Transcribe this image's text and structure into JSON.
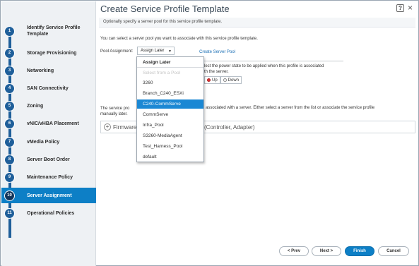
{
  "window": {
    "title": "Create Service Profile Template",
    "subtitle": "Optionally specify a server pool for this service profile template.",
    "help_label": "?",
    "close_label": "×"
  },
  "sidebar": {
    "steps": [
      {
        "num": "1",
        "label": "Identify Service Profile Template"
      },
      {
        "num": "2",
        "label": "Storage Provisioning"
      },
      {
        "num": "3",
        "label": "Networking"
      },
      {
        "num": "4",
        "label": "SAN Connectivity"
      },
      {
        "num": "5",
        "label": "Zoning"
      },
      {
        "num": "6",
        "label": "vNIC/vHBA Placement"
      },
      {
        "num": "7",
        "label": "vMedia Policy"
      },
      {
        "num": "8",
        "label": "Server Boot Order"
      },
      {
        "num": "9",
        "label": "Maintenance Policy"
      },
      {
        "num": "10",
        "label": "Server Assignment"
      },
      {
        "num": "11",
        "label": "Operational Policies"
      }
    ],
    "active_step": "10",
    "accent_color": "#0d7fc6"
  },
  "main": {
    "intro": "You can select a server pool you want to associate with this service profile template.",
    "pool_label": "Pool Assignment:",
    "pool_value": "Assign Later",
    "create_pool_link": "Create Server Pool",
    "power_text_1": "lect the power state to be applied when this profile is associated",
    "power_text_2": "th the server.",
    "power_up": "Up",
    "power_down": "Down",
    "info_left_1": "The service pro",
    "info_right_1": "associated with a server. Either select a server from the list or associate the service profile",
    "info_line_2": "manually later.",
    "firmware_label": "Firmware",
    "firmware_right": "(Controller, Adapter)"
  },
  "dropdown": {
    "options": [
      "Assign Later",
      "Select from a Pool",
      "3260",
      "Branch_C240_ESXi",
      "C240-CommServe",
      "CommServe",
      "Infra_Pool",
      "S3260-MediaAgent",
      "Test_Harness_Pool",
      "default"
    ],
    "highlighted": "C240-CommServe",
    "disabled": "Select from a Pool"
  },
  "footer": {
    "prev": "< Prev",
    "next": "Next >",
    "finish": "Finish",
    "cancel": "Cancel"
  }
}
